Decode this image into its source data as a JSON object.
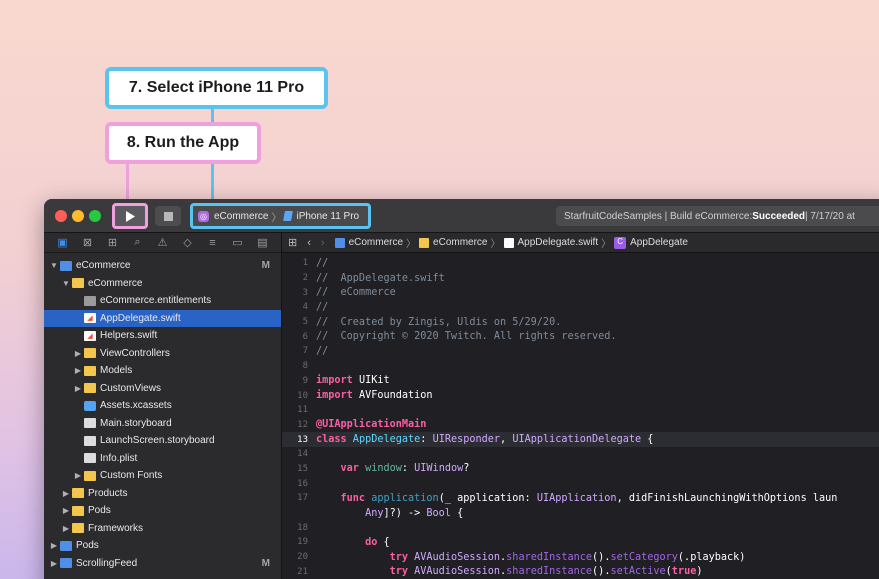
{
  "callouts": {
    "select_device": "7. Select iPhone 11 Pro",
    "run_app": "8. Run the App"
  },
  "toolbar": {
    "scheme_project": "eCommerce",
    "scheme_device": "iPhone 11 Pro",
    "status_prefix": "StarfruitCodeSamples | Build eCommerce: ",
    "status_result": "Succeeded",
    "status_suffix": " | 7/17/20 at"
  },
  "navigator": {
    "rows": [
      {
        "label": "eCommerce",
        "badge": "M"
      },
      {
        "label": "eCommerce"
      },
      {
        "label": "eCommerce.entitlements"
      },
      {
        "label": "AppDelegate.swift"
      },
      {
        "label": "Helpers.swift"
      },
      {
        "label": "ViewControllers"
      },
      {
        "label": "Models"
      },
      {
        "label": "CustomViews"
      },
      {
        "label": "Assets.xcassets"
      },
      {
        "label": "Main.storyboard"
      },
      {
        "label": "LaunchScreen.storyboard"
      },
      {
        "label": "Info.plist"
      },
      {
        "label": "Custom Fonts"
      },
      {
        "label": "Products"
      },
      {
        "label": "Pods"
      },
      {
        "label": "Frameworks"
      },
      {
        "label": "Pods"
      },
      {
        "label": "ScrollingFeed",
        "badge": "M"
      }
    ]
  },
  "jumpbar": {
    "project": "eCommerce",
    "group": "eCommerce",
    "file": "AppDelegate.swift",
    "symbol": "AppDelegate"
  },
  "editor": {
    "line_numbers": [
      "1",
      "2",
      "3",
      "4",
      "5",
      "6",
      "7",
      "8",
      "9",
      "10",
      "11",
      "12",
      "13",
      "14",
      "15",
      "16",
      "17",
      "",
      "18",
      "19",
      "20",
      "21"
    ],
    "lines": {
      "l1": "//",
      "l2": "//  AppDelegate.swift",
      "l3": "//  eCommerce",
      "l4": "//",
      "l5": "//  Created by Zingis, Uldis on 5/29/20.",
      "l6": "//  Copyright © 2020 Twitch. All rights reserved.",
      "l7": "//",
      "l9_kw": "import",
      "l9_rest": " UIKit",
      "l10_kw": "import",
      "l10_rest": " AVFoundation",
      "l12": "@UIApplicationMain",
      "l13_kw": "class",
      "l13_name": " AppDelegate",
      "l13_colon": ": ",
      "l13_t1": "UIResponder",
      "l13_comma": ", ",
      "l13_t2": "UIApplicationDelegate",
      "l13_end": " {",
      "l15_kw": "    var",
      "l15_name": " window",
      "l15_colon": ": ",
      "l15_type": "UIWindow",
      "l15_end": "?",
      "l17_kw": "    func",
      "l17_fn": " application",
      "l17_a": "(_ application: ",
      "l17_t": "UIApplication",
      "l17_b": ", didFinishLaunchingWithOptions laun",
      "l17c_a": "        Any",
      "l17c_b": "]?) -> ",
      "l17c_t": "Bool",
      "l17c_c": " {",
      "l19_kw": "        do",
      "l19_end": " {",
      "l20_kw": "            try",
      "l20_cls": " AVAudioSession",
      "l20_dot": ".",
      "l20_m1": "sharedInstance",
      "l20_p": "().",
      "l20_m2": "setCategory",
      "l20_arg": "(.playback)",
      "l21_kw": "            try",
      "l21_cls": " AVAudioSession",
      "l21_dot": ".",
      "l21_m1": "sharedInstance",
      "l21_p": "().",
      "l21_m2": "setActive",
      "l21_o": "(",
      "l21_arg": "true",
      "l21_c": ")"
    }
  }
}
